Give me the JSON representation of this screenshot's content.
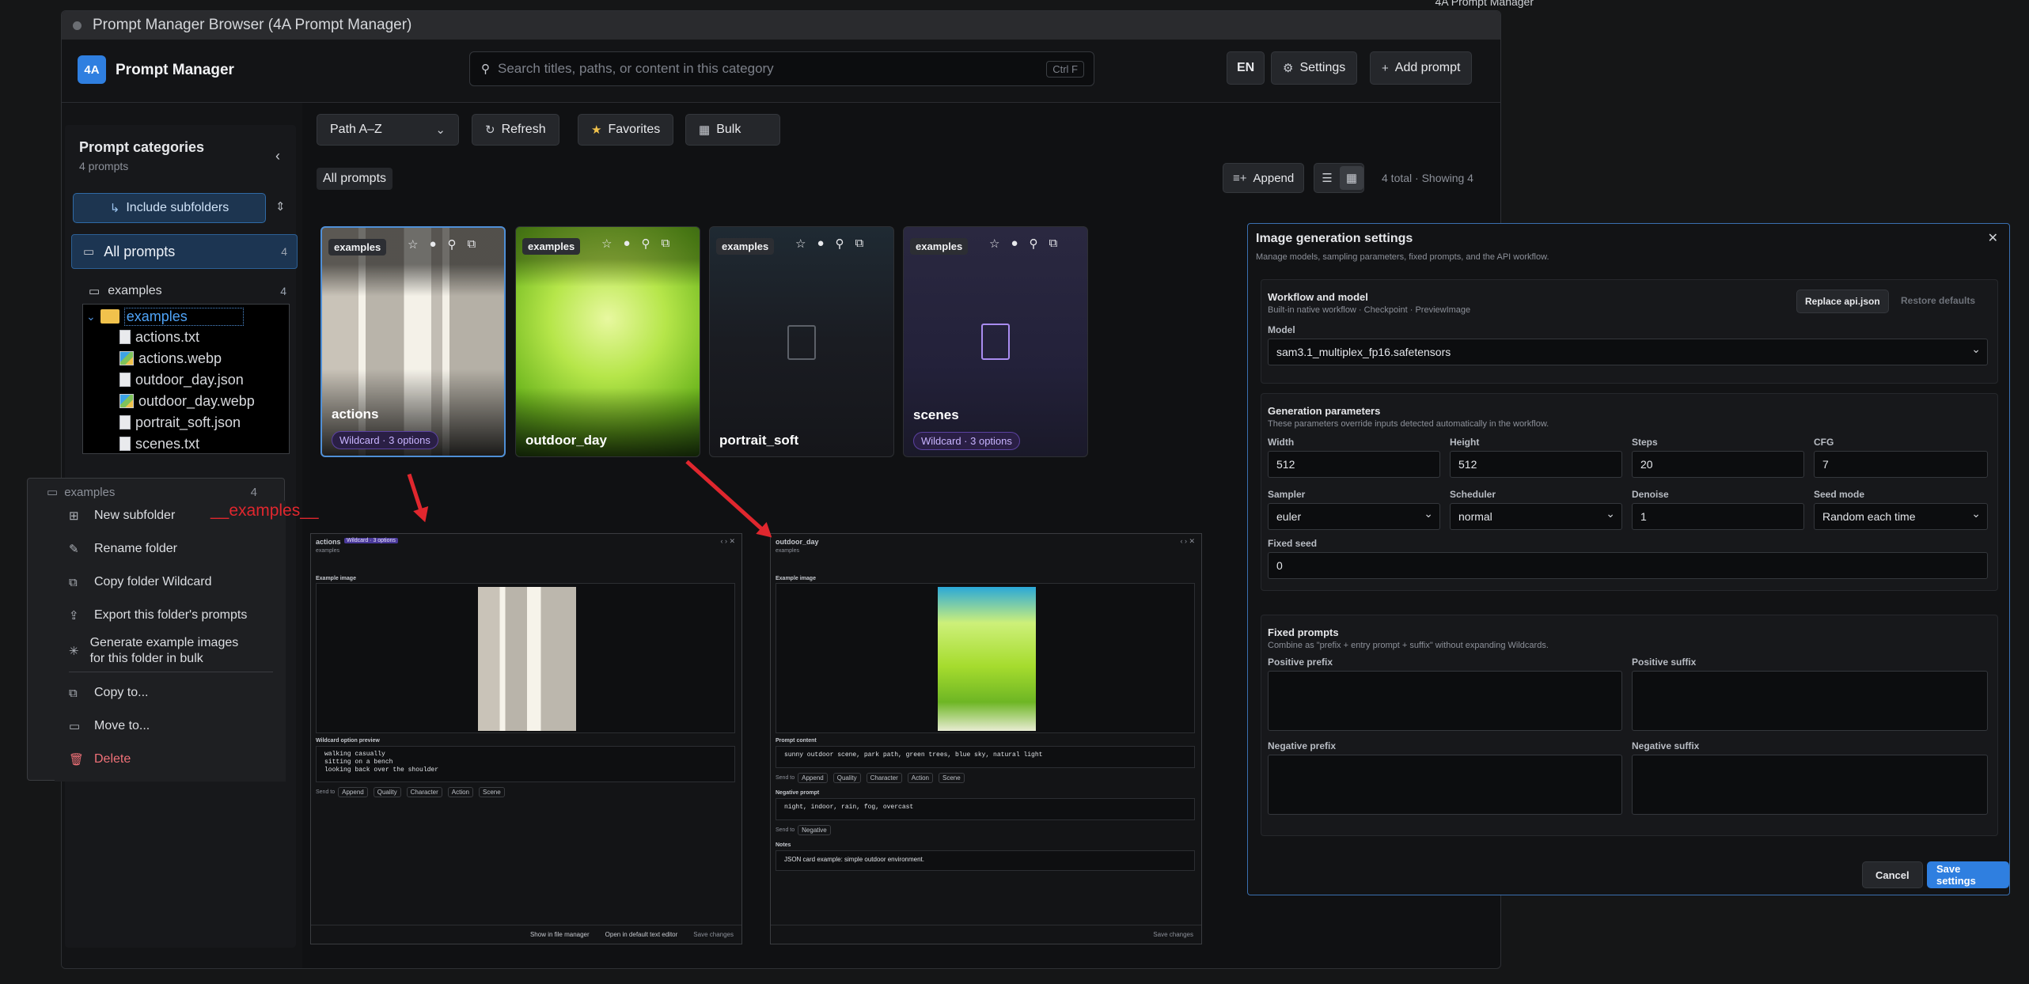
{
  "window": {
    "title": "Prompt Manager Browser (4A Prompt Manager)",
    "top_right_note": "4A Prompt Manager"
  },
  "header": {
    "logo": "4A",
    "app_name": "Prompt Manager",
    "search_placeholder": "Search titles, paths, or content in this category",
    "search_shortcut": "Ctrl F",
    "lang": "EN",
    "settings_label": "Settings",
    "add_prompt_label": "Add prompt"
  },
  "sidebar": {
    "title": "Prompt categories",
    "subtitle": "4 prompts",
    "include_subfolders": "Include subfolders",
    "all_prompts": {
      "label": "All prompts",
      "count": "4"
    },
    "folders": [
      {
        "label": "examples",
        "count": "4"
      }
    ],
    "ghost_folder": {
      "label": "examples",
      "count": "4"
    }
  },
  "tree": {
    "folder": "examples",
    "files": [
      "actions.txt",
      "actions.webp",
      "outdoor_day.json",
      "outdoor_day.webp",
      "portrait_soft.json",
      "scenes.txt"
    ]
  },
  "context_menu": {
    "items": [
      "New subfolder",
      "Rename folder",
      "Copy folder Wildcard",
      "Export this folder's prompts",
      "Generate example images for this folder in bulk",
      "Copy to...",
      "Move to...",
      "Delete"
    ]
  },
  "annotation": {
    "wildcard_text": "__examples__"
  },
  "toolbar": {
    "sort": "Path A–Z",
    "refresh": "Refresh",
    "favorites": "Favorites",
    "bulk": "Bulk",
    "breadcrumb": "All prompts",
    "append": "Append",
    "total": "4 total",
    "showing": "Showing 4"
  },
  "cards": [
    {
      "folder": "examples",
      "name": "actions",
      "badge": "Wildcard · 3 options"
    },
    {
      "folder": "examples",
      "name": "outdoor_day",
      "badge": ""
    },
    {
      "folder": "examples",
      "name": "portrait_soft",
      "badge": ""
    },
    {
      "folder": "examples",
      "name": "scenes",
      "badge": "Wildcard · 3 options"
    }
  ],
  "detail_actions": {
    "title": "actions",
    "badge": "Wildcard · 3 options",
    "path": "examples",
    "example_image": "Example image",
    "wildcard_preview": "Wildcard option preview",
    "lines": [
      "walking casually",
      "sitting on a bench",
      "looking back over the shoulder"
    ],
    "send_to": "Send to",
    "chips": [
      "Append",
      "Quality",
      "Character",
      "Action",
      "Scene"
    ],
    "footer": [
      "Show in file manager",
      "Open in default text editor",
      "Save changes"
    ]
  },
  "detail_outdoor": {
    "title": "outdoor_day",
    "path": "examples",
    "example_image": "Example image",
    "prompt_content_label": "Prompt content",
    "prompt_content": "sunny outdoor scene, park path, green trees, blue sky, natural light",
    "send_to": "Send to",
    "chips": [
      "Append",
      "Quality",
      "Character",
      "Action",
      "Scene"
    ],
    "negative_label": "Negative prompt",
    "negative": "night, indoor, rain, fog, overcast",
    "negative_chip": "Negative",
    "notes_label": "Notes",
    "notes": "JSON card example: simple outdoor environment.",
    "footer": "Save changes"
  },
  "settings": {
    "title": "Image generation settings",
    "subtitle": "Manage models, sampling parameters, fixed prompts, and the API workflow.",
    "workflow": {
      "title": "Workflow and model",
      "desc": "Built-in native workflow · Checkpoint · PreviewImage",
      "replace": "Replace api.json",
      "restore": "Restore defaults",
      "model_label": "Model",
      "model": "sam3.1_multiplex_fp16.safetensors"
    },
    "gen": {
      "title": "Generation parameters",
      "desc": "These parameters override inputs detected automatically in the workflow.",
      "width_label": "Width",
      "width": "512",
      "height_label": "Height",
      "height": "512",
      "steps_label": "Steps",
      "steps": "20",
      "cfg_label": "CFG",
      "cfg": "7",
      "sampler_label": "Sampler",
      "sampler": "euler",
      "scheduler_label": "Scheduler",
      "scheduler": "normal",
      "denoise_label": "Denoise",
      "denoise": "1",
      "seedmode_label": "Seed mode",
      "seedmode": "Random each time",
      "fixedseed_label": "Fixed seed",
      "fixedseed": "0"
    },
    "fixed": {
      "title": "Fixed prompts",
      "desc": "Combine as \"prefix + entry prompt + suffix\" without expanding Wildcards.",
      "pos_prefix": "Positive prefix",
      "pos_suffix": "Positive suffix",
      "neg_prefix": "Negative prefix",
      "neg_suffix": "Negative suffix"
    },
    "cancel": "Cancel",
    "save": "Save settings"
  },
  "colors": {
    "accent": "#2f7fe0",
    "wildcard": "#c8b4ff",
    "annotation": "#e0272e",
    "delete": "#f07178"
  }
}
